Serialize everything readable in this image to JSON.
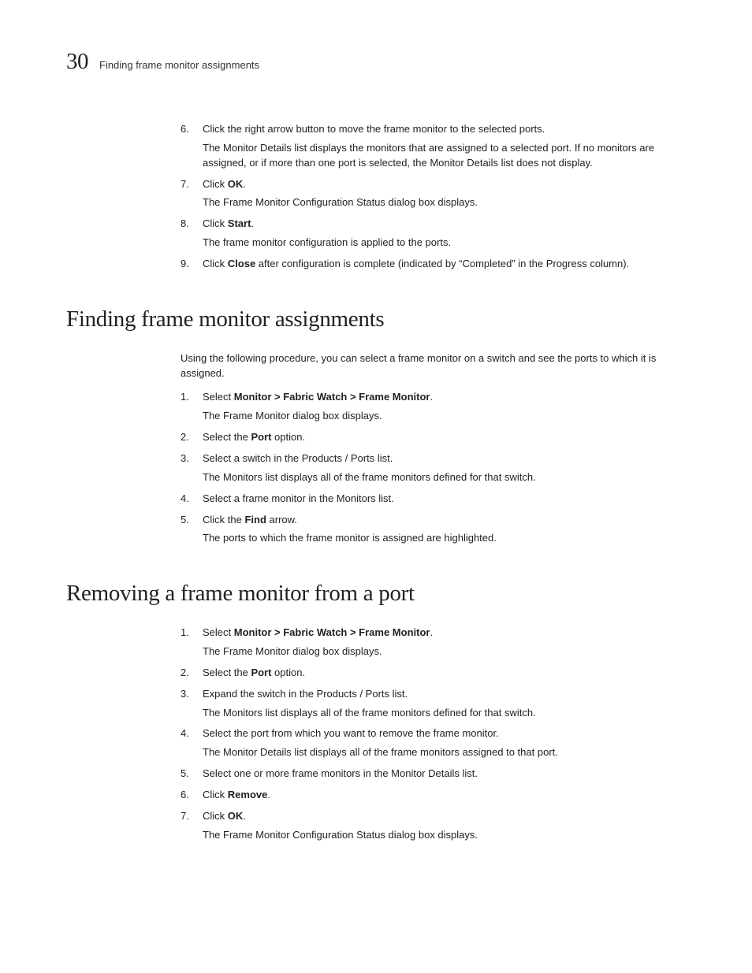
{
  "header": {
    "chapter_num": "30",
    "running_title": "Finding frame monitor assignments"
  },
  "intro_steps": [
    {
      "num": "6.",
      "run": [
        {
          "t": "Click the right arrow button to move the frame monitor to the selected ports."
        }
      ],
      "after": [
        "The Monitor Details list displays the monitors that are assigned to a selected port. If no monitors are assigned, or if more than one port is selected, the Monitor Details list does not display."
      ]
    },
    {
      "num": "7.",
      "run": [
        {
          "t": "Click "
        },
        {
          "t": "OK",
          "b": true
        },
        {
          "t": "."
        }
      ],
      "after": [
        "The Frame Monitor Configuration Status dialog box displays."
      ]
    },
    {
      "num": "8.",
      "run": [
        {
          "t": "Click "
        },
        {
          "t": "Start",
          "b": true
        },
        {
          "t": "."
        }
      ],
      "after": [
        "The frame monitor configuration is applied to the ports."
      ]
    },
    {
      "num": "9.",
      "run": [
        {
          "t": "Click "
        },
        {
          "t": "Close",
          "b": true
        },
        {
          "t": " after configuration is complete (indicated by “Completed” in the Progress column)."
        }
      ],
      "after": []
    }
  ],
  "sections": [
    {
      "title": "Finding frame monitor assignments",
      "intro": "Using the following procedure, you can select a frame monitor on a switch and see the ports to which it is assigned.",
      "steps": [
        {
          "num": "1.",
          "run": [
            {
              "t": "Select "
            },
            {
              "t": "Monitor > Fabric Watch > Frame Monitor",
              "b": true
            },
            {
              "t": "."
            }
          ],
          "after": [
            "The Frame Monitor dialog box displays."
          ]
        },
        {
          "num": "2.",
          "run": [
            {
              "t": "Select the "
            },
            {
              "t": "Port",
              "b": true
            },
            {
              "t": " option."
            }
          ],
          "after": []
        },
        {
          "num": "3.",
          "run": [
            {
              "t": "Select a switch in the Products / Ports list."
            }
          ],
          "after": [
            "The Monitors list displays all of the frame monitors defined for that switch."
          ]
        },
        {
          "num": "4.",
          "run": [
            {
              "t": "Select a frame monitor in the Monitors list."
            }
          ],
          "after": []
        },
        {
          "num": "5.",
          "run": [
            {
              "t": "Click the "
            },
            {
              "t": "Find",
              "b": true
            },
            {
              "t": " arrow."
            }
          ],
          "after": [
            "The ports to which the frame monitor is assigned are highlighted."
          ]
        }
      ]
    },
    {
      "title": "Removing a frame monitor from a port",
      "intro": "",
      "steps": [
        {
          "num": "1.",
          "run": [
            {
              "t": "Select "
            },
            {
              "t": "Monitor > Fabric Watch > Frame Monitor",
              "b": true
            },
            {
              "t": "."
            }
          ],
          "after": [
            "The Frame Monitor dialog box displays."
          ]
        },
        {
          "num": "2.",
          "run": [
            {
              "t": "Select the "
            },
            {
              "t": "Port",
              "b": true
            },
            {
              "t": " option."
            }
          ],
          "after": []
        },
        {
          "num": "3.",
          "run": [
            {
              "t": "Expand the switch in the Products / Ports list."
            }
          ],
          "after": [
            "The Monitors list displays all of the frame monitors defined for that switch."
          ]
        },
        {
          "num": "4.",
          "run": [
            {
              "t": "Select the port from which you want to remove the frame monitor."
            }
          ],
          "after": [
            "The Monitor Details list displays all of the frame monitors assigned to that port."
          ]
        },
        {
          "num": "5.",
          "run": [
            {
              "t": "Select one or more frame monitors in the Monitor Details list."
            }
          ],
          "after": []
        },
        {
          "num": "6.",
          "run": [
            {
              "t": "Click "
            },
            {
              "t": "Remove",
              "b": true
            },
            {
              "t": "."
            }
          ],
          "after": []
        },
        {
          "num": "7.",
          "run": [
            {
              "t": "Click "
            },
            {
              "t": "OK",
              "b": true
            },
            {
              "t": "."
            }
          ],
          "after": [
            "The Frame Monitor Configuration Status dialog box displays."
          ]
        }
      ]
    }
  ]
}
